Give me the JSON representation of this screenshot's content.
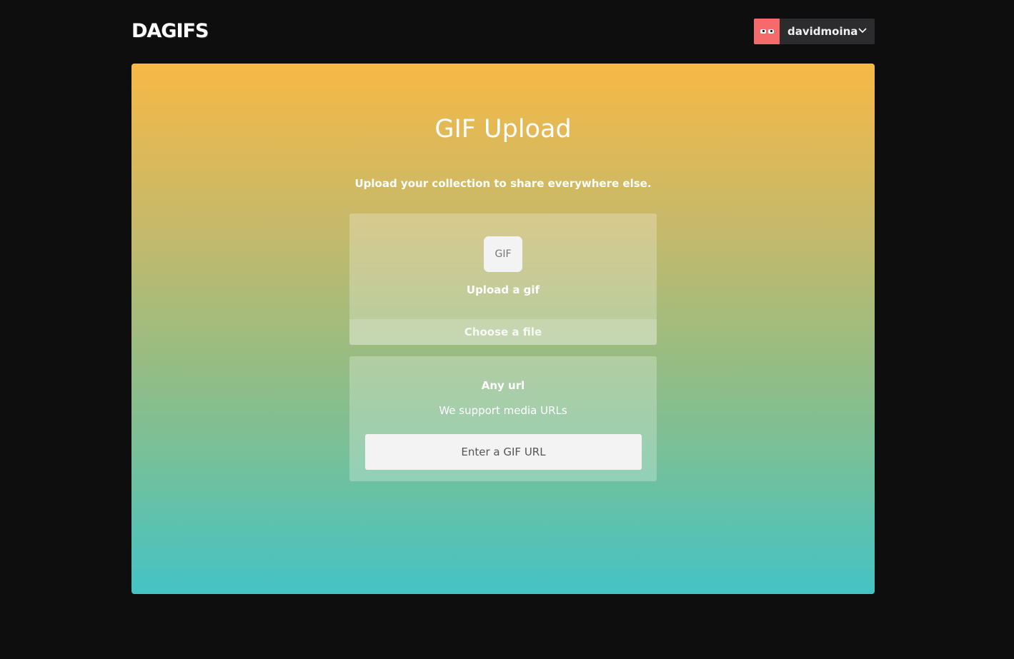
{
  "header": {
    "logo": "DAGIFS",
    "user": {
      "username": "davidmoina",
      "avatar_color": "#f56a6a"
    }
  },
  "upload": {
    "title": "GIF Upload",
    "subtitle": "Upload your collection to share everywhere else.",
    "file_box": {
      "badge": "GIF",
      "label": "Upload a gif",
      "choose_label": "Choose a file"
    },
    "url_box": {
      "title": "Any url",
      "subtitle": "We support media URLs",
      "placeholder": "Enter a GIF URL"
    }
  },
  "colors": {
    "background": "#0e0e0f",
    "gradient_top": "#f6b946",
    "gradient_bottom": "#44c3c4"
  }
}
